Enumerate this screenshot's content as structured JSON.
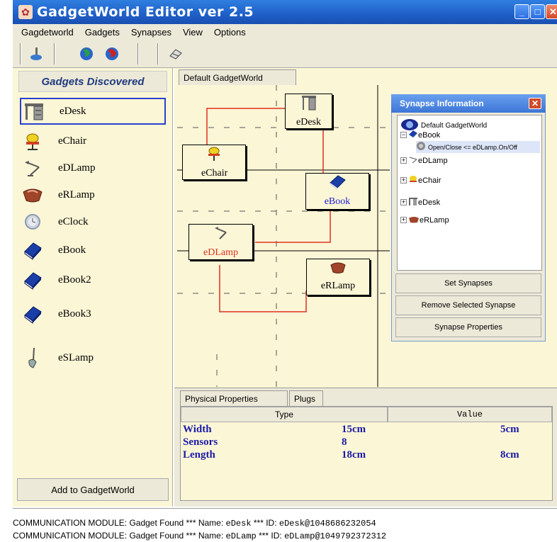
{
  "window": {
    "title": "GadgetWorld Editor ver 2.5",
    "minimize": "_",
    "maximize": "□",
    "close": "✕"
  },
  "menu": [
    "Gagdetworld",
    "Gadgets",
    "Synapses",
    "View",
    "Options"
  ],
  "toolbar": {
    "icons": [
      "broom-icon",
      "globe-green-icon",
      "globe-red-icon",
      "gadget-icon"
    ]
  },
  "sidebar": {
    "header": "Gadgets Discovered",
    "items": [
      {
        "label": "eDesk",
        "icon": "desk-icon",
        "selected": true
      },
      {
        "label": "eChair",
        "icon": "chair-icon"
      },
      {
        "label": "eDLamp",
        "icon": "desk-lamp-icon"
      },
      {
        "label": "eRLamp",
        "icon": "reading-lamp-icon"
      },
      {
        "label": "eClock",
        "icon": "clock-icon"
      },
      {
        "label": "eBook",
        "icon": "book-icon"
      },
      {
        "label": "eBook2",
        "icon": "book-icon"
      },
      {
        "label": "eBook3",
        "icon": "book-icon"
      },
      {
        "label": "eSLamp",
        "icon": "standing-lamp-icon"
      }
    ],
    "add_button": "Add to GadgetWorld"
  },
  "world": {
    "tab": "Default GadgetWorld",
    "gadgets": {
      "desk": "eDesk",
      "chair": "eChair",
      "book": "eBook",
      "dlamp": "eDLamp",
      "rlamp": "eRLamp"
    },
    "link_color": "#e03020",
    "book_label_color": "#2020d0",
    "dlamp_label_color": "#e03020"
  },
  "synapse_panel": {
    "title": "Synapse Information",
    "tree": {
      "root": "Default GadgetWorld",
      "ebook": "eBook",
      "synapse": "Open/Close <= eDLamp.On/Off",
      "edlamp": "eDLamp",
      "echair": "eChair",
      "edesk": "eDesk",
      "erlamp": "eRLamp"
    },
    "buttons": [
      "Set Synapses",
      "Remove Selected Synapse",
      "Synapse Properties"
    ]
  },
  "properties": {
    "tabs": [
      "Physical Properties",
      "Plugs"
    ],
    "columns": [
      "Type",
      "Value"
    ],
    "rows": [
      {
        "name": "Width",
        "type": "15cm",
        "value": "5cm"
      },
      {
        "name": "Sensors",
        "type": "8",
        "value": ""
      },
      {
        "name": "Length",
        "type": "18cm",
        "value": "8cm"
      }
    ]
  },
  "log": [
    {
      "a": "COMMUNICATION MODULE: Gadget Found *** Name: ",
      "name": "eDesk",
      "b": " *** ID: ",
      "id": "eDesk@1048686232054"
    },
    {
      "a": "COMMUNICATION MODULE: Gadget Found *** Name: ",
      "name": "eDLamp",
      "b": " *** ID: ",
      "id": "eDLamp@1049792372312"
    }
  ]
}
